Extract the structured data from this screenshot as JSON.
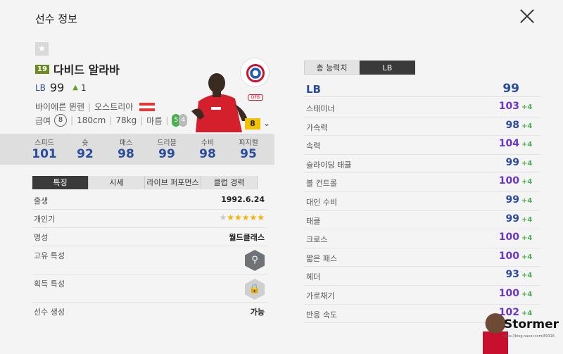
{
  "header": {
    "title": "선수 정보"
  },
  "player": {
    "season_badge": "19",
    "name": "다비드 알라바",
    "position": "LB",
    "overall": "99",
    "change": "1",
    "club": "바이에른 뮌헨",
    "nation": "오스트리아",
    "salary_label": "급여",
    "salary": "8",
    "height": "180cm",
    "weight": "78kg",
    "physique": "마름",
    "foot_left": "5",
    "foot_right": "4",
    "league_logo": "DFB",
    "level": "8"
  },
  "summary_stats": [
    {
      "label": "스피드",
      "value": "101"
    },
    {
      "label": "슛",
      "value": "92"
    },
    {
      "label": "패스",
      "value": "98"
    },
    {
      "label": "드리블",
      "value": "99"
    },
    {
      "label": "수비",
      "value": "98"
    },
    {
      "label": "피지컬",
      "value": "95"
    }
  ],
  "tabs": [
    "특징",
    "시세",
    "라이브 퍼포먼스",
    "클럽 경력"
  ],
  "details": {
    "birth_label": "출생",
    "birth": "1992.6.24",
    "popularity_label": "개인기",
    "popularity_stars": 5,
    "reputation_label": "명성",
    "reputation": "월드클래스",
    "unique_traits_label": "고유 특성",
    "acquired_traits_label": "획득 특성",
    "create_label": "선수 생성",
    "create": "가능"
  },
  "right_panel": {
    "tabs": [
      "총 능력치",
      "LB"
    ],
    "position": "LB",
    "position_value": "99",
    "attributes": [
      {
        "label": "스태미너",
        "value": "103",
        "bonus": "+4",
        "color": "#6a35c9"
      },
      {
        "label": "가속력",
        "value": "98",
        "bonus": "+4",
        "color": "#2a4d9b"
      },
      {
        "label": "속력",
        "value": "104",
        "bonus": "+4",
        "color": "#6a35c9"
      },
      {
        "label": "슬라이딩 태클",
        "value": "99",
        "bonus": "+4",
        "color": "#2a4d9b"
      },
      {
        "label": "볼 컨트롤",
        "value": "100",
        "bonus": "+4",
        "color": "#6a35c9"
      },
      {
        "label": "대인 수비",
        "value": "99",
        "bonus": "+4",
        "color": "#2a4d9b"
      },
      {
        "label": "태클",
        "value": "99",
        "bonus": "+4",
        "color": "#2a4d9b"
      },
      {
        "label": "크로스",
        "value": "100",
        "bonus": "+4",
        "color": "#6a35c9"
      },
      {
        "label": "짧은 패스",
        "value": "100",
        "bonus": "+4",
        "color": "#6a35c9"
      },
      {
        "label": "헤더",
        "value": "93",
        "bonus": "+4",
        "color": "#2a4d9b"
      },
      {
        "label": "가로채기",
        "value": "100",
        "bonus": "+4",
        "color": "#6a35c9"
      },
      {
        "label": "반응 속도",
        "value": "102",
        "bonus": "+4",
        "color": "#6a35c9"
      }
    ]
  },
  "watermark": {
    "text": "Stormer",
    "url": "https://blog.naver.com/89316"
  }
}
